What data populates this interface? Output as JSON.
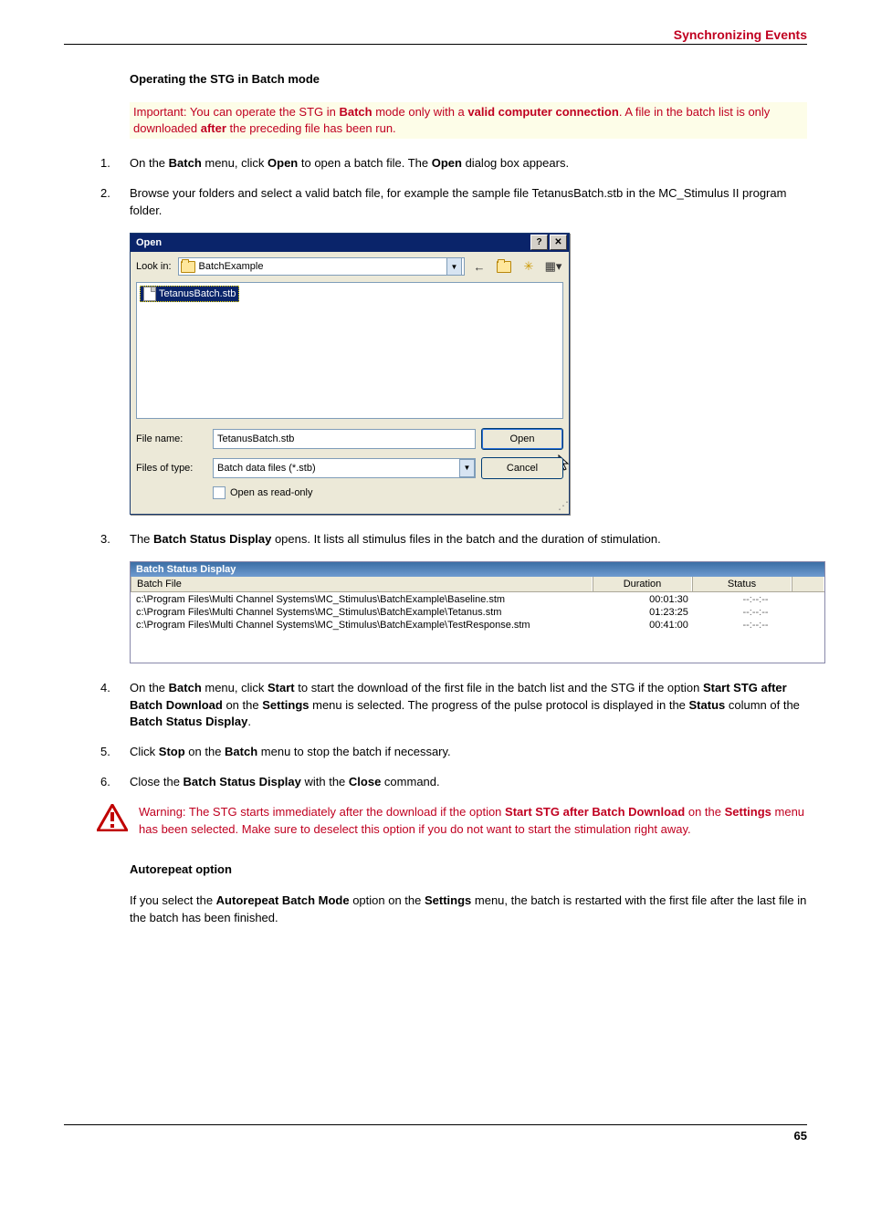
{
  "header": {
    "section_title": "Synchronizing Events"
  },
  "headings": {
    "operating": "Operating the STG in Batch mode",
    "autorepeat": "Autorepeat option"
  },
  "important_note": {
    "prefix": "Important: You can operate the STG in ",
    "b1": "Batch",
    "mid1": " mode only with a ",
    "b2": "valid computer connection",
    "line2a": ". A file in the batch list is only downloaded ",
    "b3": "after",
    "line2b": " the preceding file has been run."
  },
  "steps": {
    "s1": {
      "num": "1.",
      "a": "On the ",
      "b1": "Batch",
      "b": " menu, click ",
      "b2": "Open",
      "c": " to open a batch file. The ",
      "b3": "Open",
      "d": " dialog box appears."
    },
    "s2": {
      "num": "2.",
      "text": "Browse your folders and select a valid batch file, for example the sample file TetanusBatch.stb in the MC_Stimulus II program folder."
    },
    "s3": {
      "num": "3.",
      "a": "The ",
      "b1": "Batch Status Display",
      "b": " opens. It lists all stimulus files in the batch and the duration of stimulation."
    },
    "s4": {
      "num": "4.",
      "a": "On the ",
      "b1": "Batch",
      "b": " menu, click ",
      "b2": "Start",
      "c": " to start the download of the first file in the batch list and the STG if the option ",
      "b3": "Start STG after Batch Download",
      "d": " on the ",
      "b4": "Settings",
      "e": " menu is selected. The progress of the pulse protocol is displayed in the ",
      "b5": "Status",
      "f": " column of the ",
      "b6": "Batch Status Display",
      "g": "."
    },
    "s5": {
      "num": "5.",
      "a": "Click ",
      "b1": "Stop",
      "b": " on the ",
      "b2": "Batch",
      "c": " menu to stop the batch if necessary."
    },
    "s6": {
      "num": "6.",
      "a": "Close the ",
      "b1": "Batch Status Display",
      "b": " with the ",
      "b2": "Close",
      "c": " command."
    }
  },
  "open_dialog": {
    "title": "Open",
    "lookin_label": "Look in:",
    "lookin_value": "BatchExample",
    "file_selected": "TetanusBatch.stb",
    "filename_label": "File name:",
    "filename_value": "TetanusBatch.stb",
    "filetype_label": "Files of type:",
    "filetype_value": "Batch data files (*.stb)",
    "open_button": "Open",
    "cancel_button": "Cancel",
    "readonly_label": "Open as read-only",
    "help_btn": "?",
    "close_btn": "✕"
  },
  "batch_display": {
    "title": "Batch Status Display",
    "columns": {
      "file": "Batch File",
      "duration": "Duration",
      "status": "Status"
    },
    "rows": [
      {
        "file": "c:\\Program Files\\Multi Channel Systems\\MC_Stimulus\\BatchExample\\Baseline.stm",
        "duration": "00:01:30",
        "status": "--:--:--"
      },
      {
        "file": "c:\\Program Files\\Multi Channel Systems\\MC_Stimulus\\BatchExample\\Tetanus.stm",
        "duration": "01:23:25",
        "status": "--:--:--"
      },
      {
        "file": "c:\\Program Files\\Multi Channel Systems\\MC_Stimulus\\BatchExample\\TestResponse.stm",
        "duration": "00:41:00",
        "status": "--:--:--"
      }
    ]
  },
  "warning": {
    "a": "Warning: The STG starts immediately after the download if the option ",
    "b1": "Start STG after Batch Download",
    "b": " on the ",
    "b2": "Settings",
    "c": " menu has been selected. Make sure to deselect this option if you do not want to start the stimulation right away."
  },
  "autorepeat_para": {
    "a": "If you select the ",
    "b1": "Autorepeat Batch Mode",
    "b": " option on the ",
    "b2": "Settings",
    "c": " menu, the batch is restarted with the first file after the last file in the batch has been finished."
  },
  "page_number": "65"
}
